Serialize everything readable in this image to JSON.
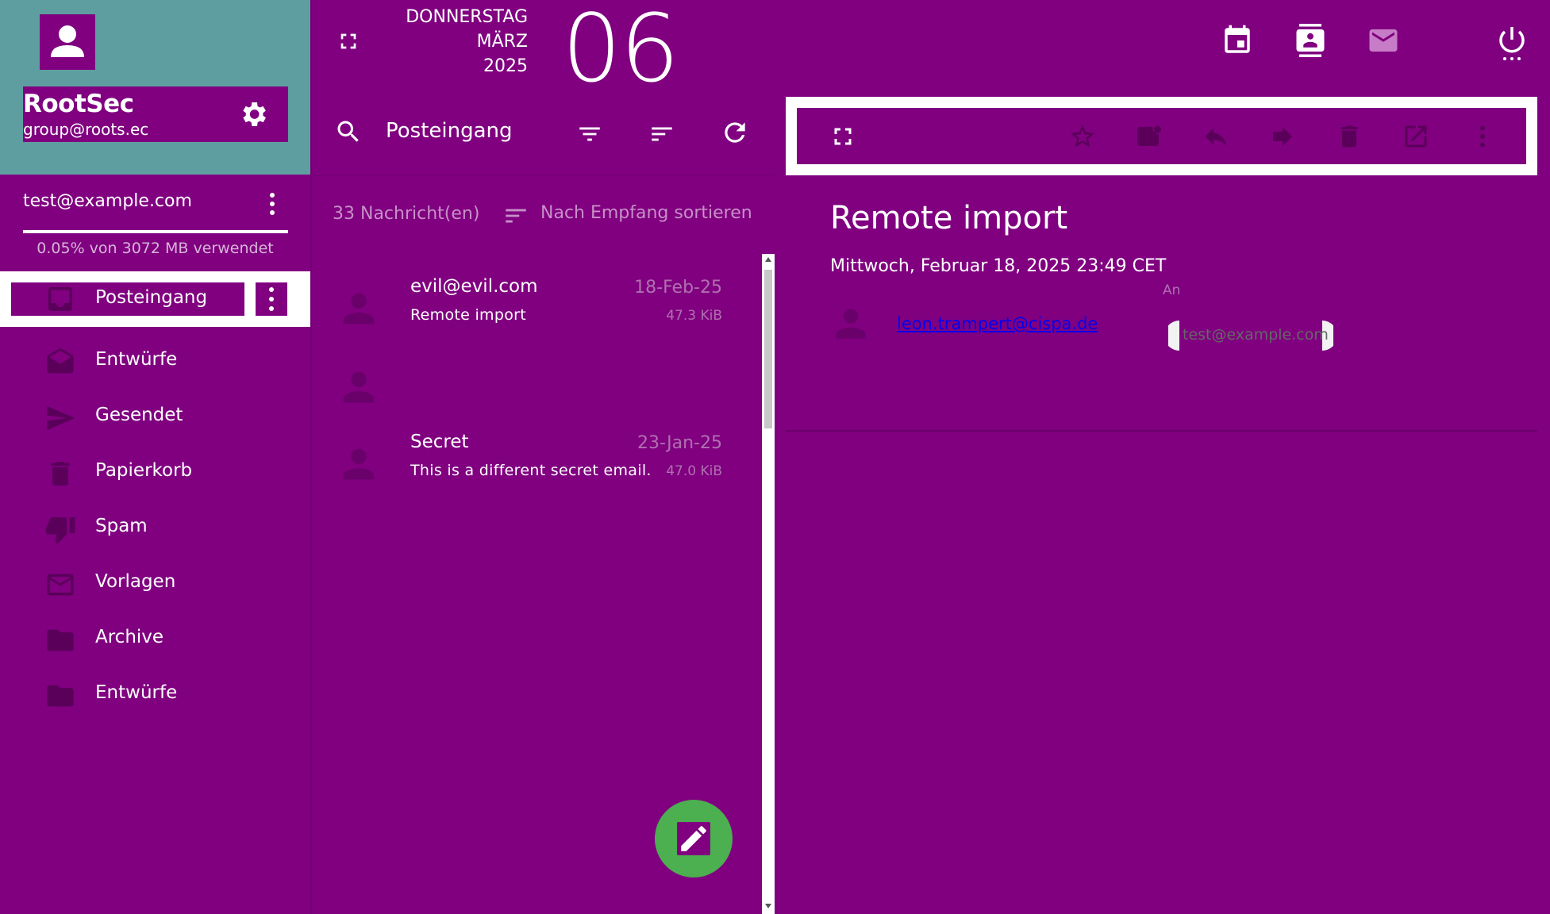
{
  "profile": {
    "name": "RootSec",
    "email": "group@roots.ec"
  },
  "account": {
    "email": "test@example.com",
    "quota": "0.05% von 3072 MB verwendet"
  },
  "folders": [
    {
      "label": "Posteingang",
      "icon": "inbox-icon"
    },
    {
      "label": "Entwürfe",
      "icon": "drafts-icon"
    },
    {
      "label": "Gesendet",
      "icon": "send-icon"
    },
    {
      "label": "Papierkorb",
      "icon": "trash-icon"
    },
    {
      "label": "Spam",
      "icon": "thumb-down-icon"
    },
    {
      "label": "Vorlagen",
      "icon": "mail-icon"
    },
    {
      "label": "Archive",
      "icon": "folder-icon"
    },
    {
      "label": "Entwürfe",
      "icon": "folder-icon"
    }
  ],
  "date": {
    "weekday": "DONNERSTAG",
    "month": "MÄRZ",
    "year": "2025",
    "day": "06"
  },
  "list": {
    "title": "Posteingang",
    "count": "33 Nachricht(en)",
    "sort_label": "Nach Empfang sortieren",
    "messages": [
      {
        "sender": "evil@evil.com",
        "subject": "Remote import",
        "date": "18-Feb-25",
        "size": "47.3 KiB"
      },
      {
        "sender": "",
        "subject": "",
        "date": "",
        "size": ""
      },
      {
        "sender": "Secret",
        "subject": "This is a different secret email.",
        "date": "23-Jan-25",
        "size": "47.0 KiB"
      }
    ]
  },
  "reader": {
    "subject": "Remote import",
    "date": "Mittwoch, Februar 18, 2025 23:49 CET",
    "to_label": "An",
    "from": "leon.trampert@cispa.de",
    "to": "test@example.com"
  },
  "colors": {
    "background": "#800080",
    "profile_bg": "#5f9ea0",
    "fab": "#4caf50",
    "highlight": "#ffffff"
  }
}
